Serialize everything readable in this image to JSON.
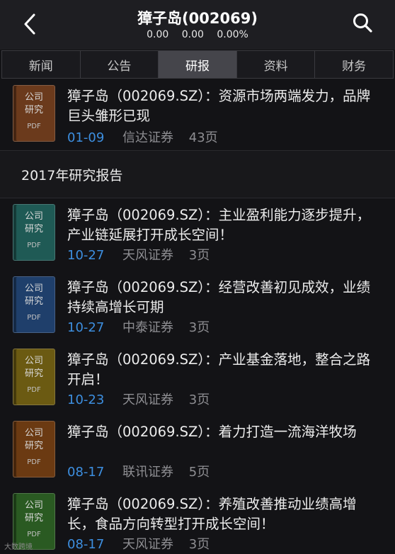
{
  "header": {
    "title": "獐子岛(002069)",
    "price": "0.00",
    "change": "0.00",
    "change_pct": "0.00%",
    "back_icon": "chevron-left-icon",
    "search_icon": "search-icon"
  },
  "tabs": [
    {
      "label": "新闻",
      "active": false
    },
    {
      "label": "公告",
      "active": false
    },
    {
      "label": "研报",
      "active": true
    },
    {
      "label": "资料",
      "active": false
    },
    {
      "label": "财务",
      "active": false
    }
  ],
  "book_label": {
    "line1": "公司",
    "line2": "研究",
    "pdf": "PDF"
  },
  "reports": [
    {
      "title": "獐子岛（002069.SZ）：资源市场两端发力，品牌巨头雏形已现",
      "date": "01-09",
      "broker": "信达证券",
      "pages": "43页",
      "cover_color": "#6b3a1c"
    },
    {
      "title": "獐子岛（002069.SZ）：主业盈利能力逐步提升，产业链延展打开成长空间！",
      "date": "10-27",
      "broker": "天风证券",
      "pages": "3页",
      "cover_color": "#1f5a55"
    },
    {
      "title": "獐子岛（002069.SZ）：经营改善初见成效，业绩持续高增长可期",
      "date": "10-27",
      "broker": "中泰证券",
      "pages": "3页",
      "cover_color": "#1f3f6b"
    },
    {
      "title": "獐子岛（002069.SZ）：产业基金落地，整合之路开启！",
      "date": "10-23",
      "broker": "天风证券",
      "pages": "3页",
      "cover_color": "#6b5a12"
    },
    {
      "title": "獐子岛（002069.SZ）：着力打造一流海洋牧场",
      "date": "08-17",
      "broker": "联讯证券",
      "pages": "5页",
      "cover_color": "#6b3a12"
    },
    {
      "title": "獐子岛（002069.SZ）：养殖改善推动业绩高增长，食品方向转型打开成长空间！",
      "date": "08-17",
      "broker": "天风证券",
      "pages": "3页",
      "cover_color": "#2a5a22"
    }
  ],
  "section_title": "2017年研究报告",
  "watermark": "大数跨境"
}
